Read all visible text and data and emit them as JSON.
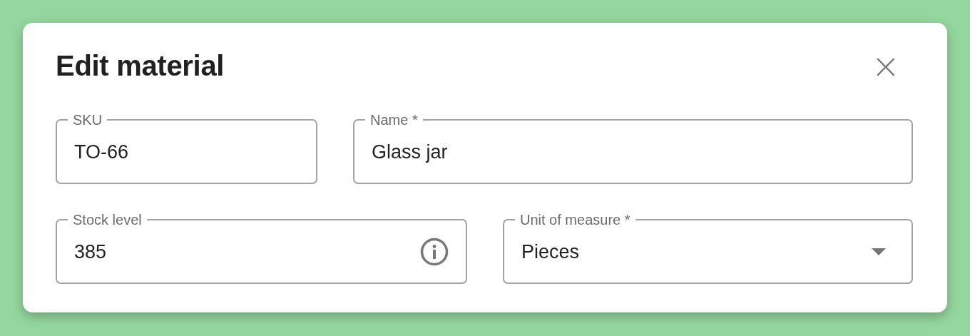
{
  "dialog": {
    "title": "Edit material",
    "close": "×"
  },
  "rows": [
    {
      "fields": [
        {
          "kind": "text",
          "label": "SKU",
          "value": "TO-66"
        },
        {
          "kind": "text",
          "label": "Name *",
          "value": "Glass jar"
        }
      ]
    },
    {
      "fields": [
        {
          "kind": "info",
          "label": "Stock level",
          "value": "385"
        },
        {
          "kind": "select",
          "label": "Unit of measure *",
          "value": "Pieces"
        }
      ]
    }
  ]
}
